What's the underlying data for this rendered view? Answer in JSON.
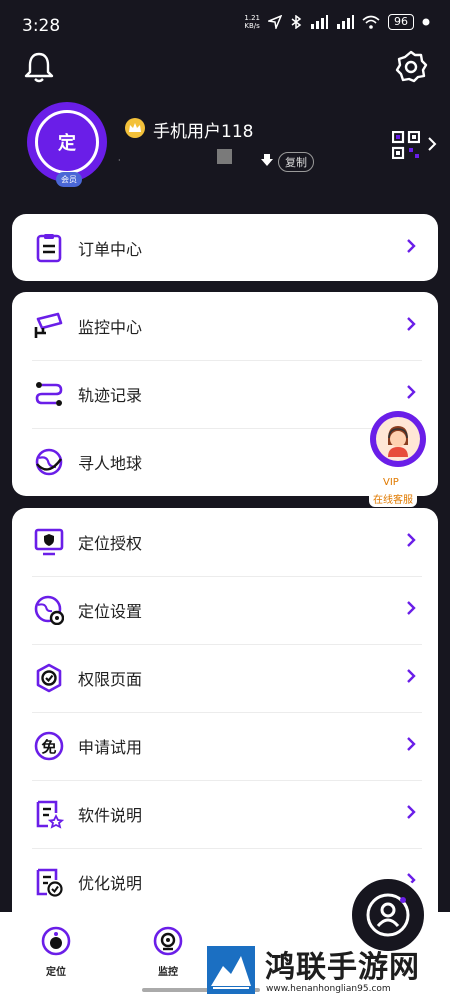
{
  "status_bar": {
    "time": "3:28",
    "net_speed": "1.21\nKB/s",
    "battery": "96"
  },
  "profile": {
    "avatar_text": "定",
    "member_badge": "会员",
    "username": "手机用户118",
    "dot": "·",
    "copy_label": "复制"
  },
  "cards": [
    {
      "items": [
        {
          "label": "订单中心",
          "icon": "clipboard-icon"
        }
      ]
    },
    {
      "items": [
        {
          "label": "监控中心",
          "icon": "camera-icon"
        },
        {
          "label": "轨迹记录",
          "icon": "route-icon"
        },
        {
          "label": "寻人地球",
          "icon": "globe-icon"
        }
      ]
    },
    {
      "items": [
        {
          "label": "定位授权",
          "icon": "shield-monitor-icon"
        },
        {
          "label": "定位设置",
          "icon": "globe-gear-icon"
        },
        {
          "label": "权限页面",
          "icon": "check-badge-icon"
        },
        {
          "label": "申请试用",
          "icon": "free-icon"
        },
        {
          "label": "软件说明",
          "icon": "doc-star-icon"
        },
        {
          "label": "优化说明",
          "icon": "doc-check-icon"
        }
      ]
    }
  ],
  "vip": {
    "title": "VIP",
    "subtitle": "在线客服"
  },
  "bottom_nav": [
    {
      "label": "定位"
    },
    {
      "label": "监控"
    }
  ],
  "watermark": {
    "title": "鸿联手游网",
    "url": "www.henanhonglian95.com"
  },
  "colors": {
    "background": "#17161f",
    "accent": "#6a1ee8",
    "card": "#ffffff"
  }
}
